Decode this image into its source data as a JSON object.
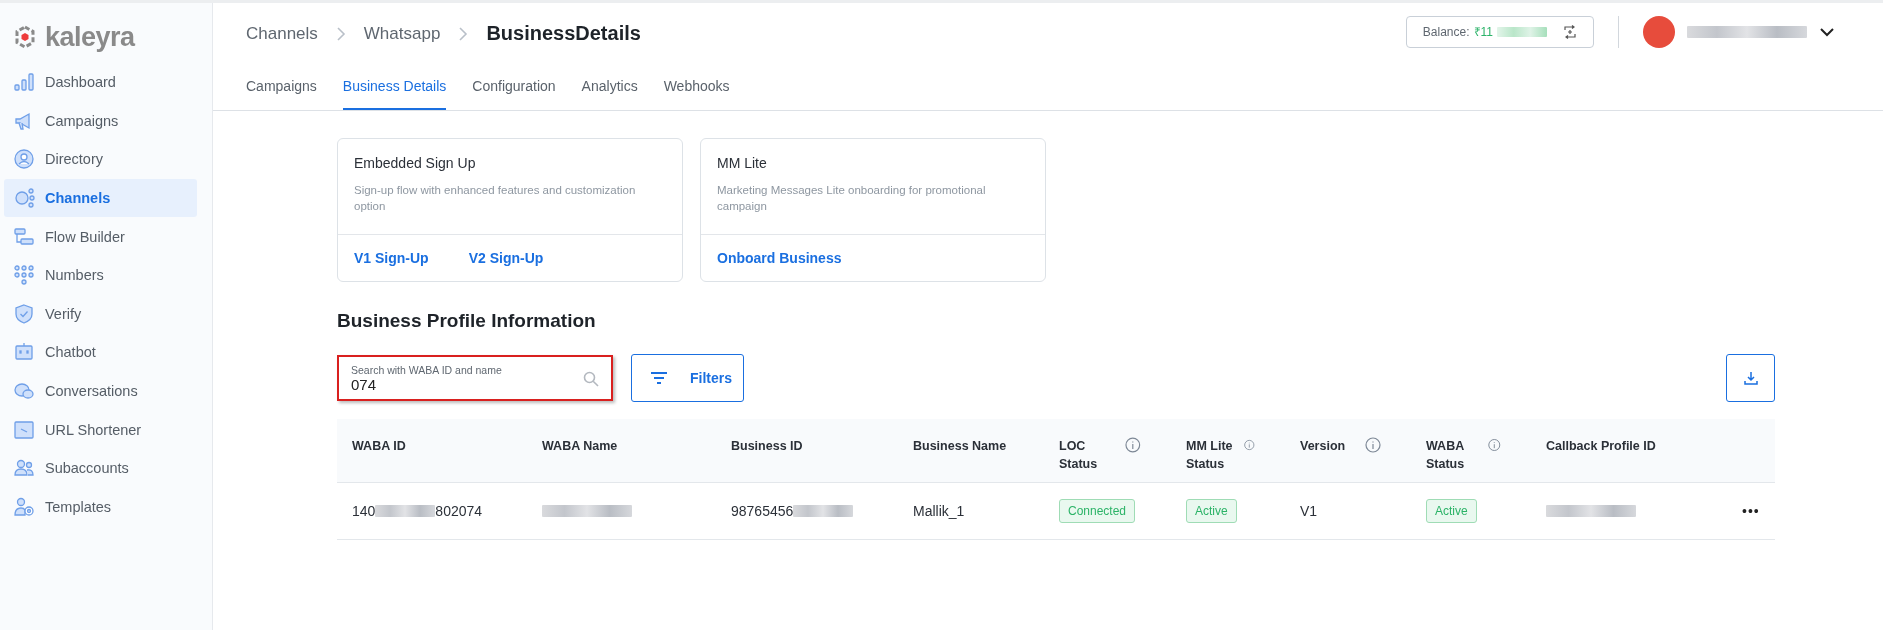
{
  "brand": {
    "name": "kaleyra"
  },
  "sidebar": {
    "items": [
      {
        "label": "Dashboard",
        "selected": false
      },
      {
        "label": "Campaigns",
        "selected": false
      },
      {
        "label": "Directory",
        "selected": false
      },
      {
        "label": "Channels",
        "selected": true
      },
      {
        "label": "Flow Builder",
        "selected": false
      },
      {
        "label": "Numbers",
        "selected": false
      },
      {
        "label": "Verify",
        "selected": false
      },
      {
        "label": "Chatbot",
        "selected": false
      },
      {
        "label": "Conversations",
        "selected": false
      },
      {
        "label": "URL Shortener",
        "selected": false
      },
      {
        "label": "Subaccounts",
        "selected": false
      },
      {
        "label": "Templates",
        "selected": false
      }
    ]
  },
  "breadcrumb": [
    "Channels",
    "Whatsapp",
    "BusinessDetails"
  ],
  "balance": {
    "label": "Balance:",
    "value": "₹11"
  },
  "tabs": [
    {
      "label": "Campaigns",
      "selected": false
    },
    {
      "label": "Business Details",
      "selected": true
    },
    {
      "label": "Configuration",
      "selected": false
    },
    {
      "label": "Analytics",
      "selected": false
    },
    {
      "label": "Webhooks",
      "selected": false
    }
  ],
  "cards": [
    {
      "title": "Embedded Sign Up",
      "description": "Sign-up flow with enhanced features and customization option",
      "links": [
        "V1 Sign-Up",
        "V2 Sign-Up"
      ]
    },
    {
      "title": "MM Lite",
      "description": "Marketing Messages Lite onboarding for promotional campaign",
      "links": [
        "Onboard Business"
      ]
    }
  ],
  "section_title": "Business Profile Information",
  "search": {
    "placeholder": "Search with WABA ID and name",
    "value": "074"
  },
  "filters_button": "Filters",
  "table": {
    "columns": [
      {
        "label": "WABA ID",
        "kind": "plain"
      },
      {
        "label": "WABA Name",
        "kind": "plain"
      },
      {
        "label": "Business ID",
        "kind": "plain"
      },
      {
        "label": "Business Name",
        "kind": "plain"
      },
      {
        "label": "LOC Status",
        "kind": "info"
      },
      {
        "label": "MM Lite Status",
        "kind": "info"
      },
      {
        "label": "Version",
        "kind": "info"
      },
      {
        "label": "WABA Status",
        "kind": "info"
      },
      {
        "label": "Callback Profile ID",
        "kind": "plain"
      }
    ],
    "rows": [
      {
        "cells": [
          {
            "kind": "partial",
            "text": "140",
            "rest": "802074"
          },
          {
            "kind": "blurred"
          },
          {
            "kind": "partial",
            "text": "98765456"
          },
          {
            "kind": "text",
            "text": "Mallik_1"
          },
          {
            "kind": "badge",
            "text": "Connected"
          },
          {
            "kind": "badge",
            "text": "Active"
          },
          {
            "kind": "text",
            "text": "V1"
          },
          {
            "kind": "badge",
            "text": "Active"
          },
          {
            "kind": "blurred"
          }
        ],
        "menu": "•••"
      }
    ]
  }
}
